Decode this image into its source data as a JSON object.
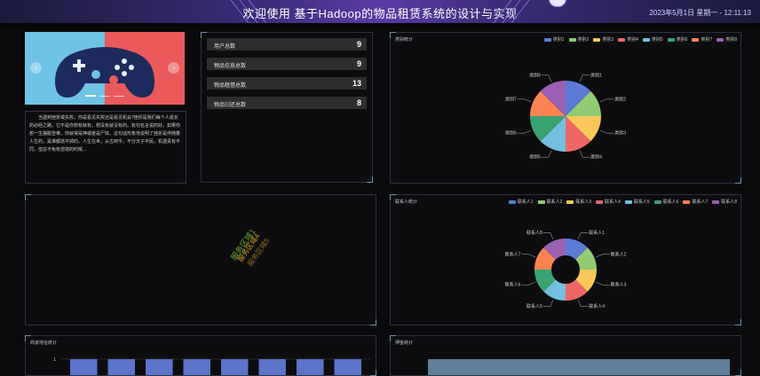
{
  "header": {
    "title": "欢迎使用 基于Hadoop的物品租赁系统的设计与实现",
    "datetime": "2023年5月1日 星期一 - 12:11:13"
  },
  "intro": {
    "text": "当遇到挫折或失败，你是看见失败还是看见机会?挫折是我们每个人成长的必经之路，它不是你想有就有，想没有就没有的。有句名言说的好，如果你想一生摆脱苦难，你就得是神或者是尸体。这句话形象地说明了挫折是伴随着人生的，是谁都逃不掉的。人生在世，从古到今，不分天子平民，机遇贵有不同，但总不免有逆境的时候..."
  },
  "stats": [
    {
      "label": "用户总数",
      "value": "9"
    },
    {
      "label": "物品信息总数",
      "value": "9"
    },
    {
      "label": "物品租借总数",
      "value": "13"
    },
    {
      "label": "物品归还总数",
      "value": "8"
    }
  ],
  "panels": {
    "category": {
      "title": "类别统计"
    },
    "contact": {
      "title": "联系人统计"
    },
    "merchant": {
      "title": "商家地址统计"
    },
    "lease": {
      "title": "押金统计"
    }
  },
  "wordcloud": [
    {
      "text": "服务区域1",
      "color": "#6ea33a"
    },
    {
      "text": "服务区域4",
      "color": "#d4a017"
    },
    {
      "text": "服务区域5",
      "color": "#8c6b1a"
    }
  ],
  "colors": [
    "#5b7bd5",
    "#91cc75",
    "#fac858",
    "#ee6666",
    "#73c0de",
    "#3ba272",
    "#fc8452",
    "#9a60b4"
  ],
  "chart_data": [
    {
      "type": "pie",
      "title": "类别统计",
      "categories": [
        "类别1",
        "类别2",
        "类别3",
        "类别4",
        "类别5",
        "类别6",
        "类别7",
        "类别8"
      ],
      "values": [
        1,
        1,
        1,
        1,
        1,
        1,
        1,
        1
      ],
      "outer_labels": [
        "类别1",
        "类别2",
        "类别3",
        "类别4",
        "类别5",
        "类别6",
        "类别7",
        "类别8"
      ]
    },
    {
      "type": "pie",
      "title": "联系人统计",
      "categories": [
        "联系人1",
        "联系人2",
        "联系人3",
        "联系人4",
        "联系人5",
        "联系人6",
        "联系人7",
        "联系人8"
      ],
      "values": [
        1,
        1,
        1,
        1,
        1,
        1,
        1,
        1
      ],
      "donut": true,
      "outer_labels": [
        "联系人1",
        "联系人2",
        "联系人3",
        "联系人4",
        "联系人5",
        "联系人6",
        "联系人7",
        "联系人8"
      ]
    },
    {
      "type": "bar",
      "title": "商家地址统计",
      "values": [
        1,
        1,
        1,
        1,
        1,
        1,
        1,
        1
      ],
      "y_tick": "1"
    },
    {
      "type": "area",
      "title": "押金统计"
    }
  ]
}
